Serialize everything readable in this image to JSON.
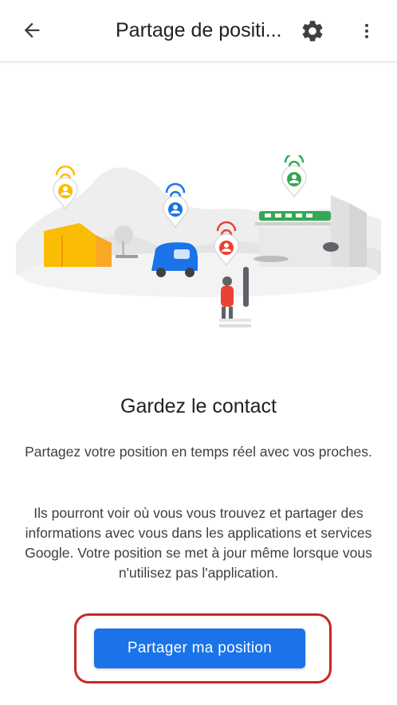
{
  "appbar": {
    "title": "Partage de positi...",
    "icons": {
      "back": "arrow-back-icon",
      "settings": "gear-icon",
      "more": "more-vert-icon"
    }
  },
  "colors": {
    "accent": "#1a73e8",
    "highlight": "#c62828",
    "pin_yellow": "#fbbc04",
    "pin_blue": "#1a73e8",
    "pin_red": "#ea4335",
    "pin_green": "#34a853"
  },
  "content": {
    "heading": "Gardez le contact",
    "paragraph1": "Partagez votre position en temps réel avec vos proches.",
    "paragraph2": "Ils pourront voir où vous vous trouvez et partager des informations avec vous dans les applications et services Google. Votre position se met à jour même lorsque vous n'utilisez pas l'application."
  },
  "action": {
    "share_label": "Partager ma position"
  }
}
